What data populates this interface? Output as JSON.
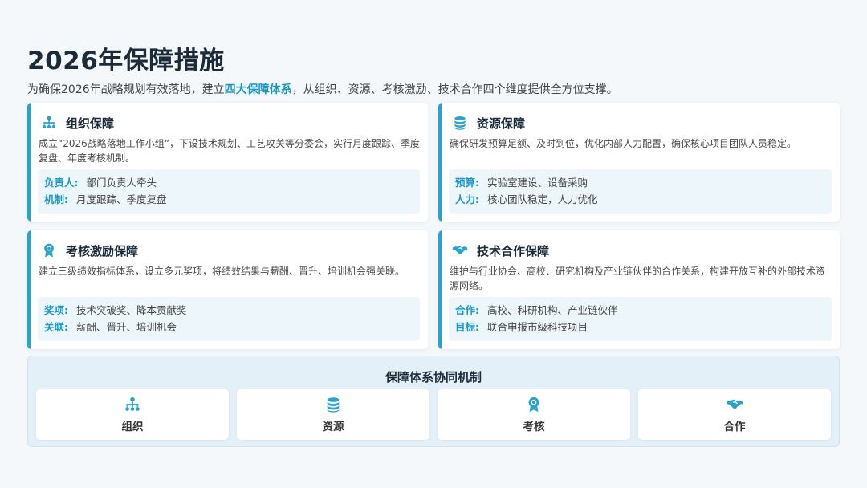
{
  "title": "2026年保障措施",
  "subtitle": {
    "before": "为确保2026年战略规划有效落地，建立",
    "highlight": "四大保障体系",
    "after": "，从组织、资源、考核激励、技术合作四个维度提供全方位支撑。"
  },
  "colors": {
    "accent": "#29a3cc",
    "highlight": "#1a96c4",
    "heading": "#1c2b3a"
  },
  "cards": [
    {
      "icon": "org-chart-icon",
      "title": "组织保障",
      "desc": "成立“2026战略落地工作小组”，下设技术规划、工艺攻关等分委会，实行月度跟踪、季度复盘、年度考核机制。",
      "rows": [
        {
          "key": "负责人:",
          "value": "部门负责人牵头"
        },
        {
          "key": "机制:",
          "value": "月度跟踪、季度复盘"
        }
      ]
    },
    {
      "icon": "coins-icon",
      "title": "资源保障",
      "desc": "确保研发预算足额、及时到位，优化内部人力配置，确保核心项目团队人员稳定。",
      "rows": [
        {
          "key": "预算:",
          "value": "实验室建设、设备采购"
        },
        {
          "key": "人力:",
          "value": "核心团队稳定，人力优化"
        }
      ]
    },
    {
      "icon": "award-icon",
      "title": "考核激励保障",
      "desc": "建立三级绩效指标体系，设立多元奖项，将绩效结果与薪酬、晋升、培训机会强关联。",
      "rows": [
        {
          "key": "奖项:",
          "value": "技术突破奖、降本贡献奖"
        },
        {
          "key": "关联:",
          "value": "薪酬、晋升、培训机会"
        }
      ]
    },
    {
      "icon": "handshake-icon",
      "title": "技术合作保障",
      "desc": "维护与行业协会、高校、研究机构及产业链伙伴的合作关系，构建开放互补的外部技术资源网络。",
      "rows": [
        {
          "key": "合作:",
          "value": "高校、科研机构、产业链伙伴"
        },
        {
          "key": "目标:",
          "value": "联合申报市级科技项目"
        }
      ]
    }
  ],
  "mechanism": {
    "title": "保障体系协同机制",
    "items": [
      {
        "icon": "org-chart-icon",
        "label": "组织"
      },
      {
        "icon": "coins-icon",
        "label": "资源"
      },
      {
        "icon": "award-icon",
        "label": "考核"
      },
      {
        "icon": "handshake-icon",
        "label": "合作"
      }
    ]
  }
}
